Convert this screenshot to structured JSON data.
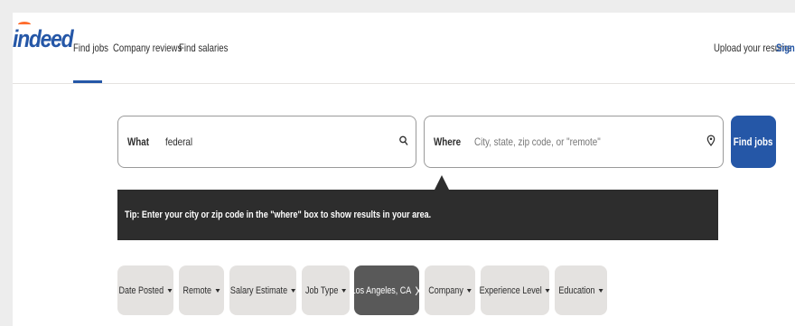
{
  "brand": {
    "logo_text": "indeed",
    "color": "#2557a7",
    "accent": "#ff6d2e"
  },
  "nav": {
    "find_jobs": "Find jobs",
    "company_reviews": "Company reviews",
    "find_salaries": "Find salaries",
    "upload_resume": "Upload your resume",
    "sign_in": "Sign i"
  },
  "search": {
    "what": {
      "label": "What",
      "value": "federal",
      "icon": "search-icon"
    },
    "where": {
      "label": "Where",
      "placeholder": "City, state, zip code, or \"remote\"",
      "icon": "location-pin-icon"
    },
    "submit_label": "Find jobs"
  },
  "tip": {
    "text": "Tip: Enter your city or zip code in the \"where\" box to show results in your area."
  },
  "filters": [
    {
      "label": "Date Posted",
      "active": false
    },
    {
      "label": "Remote",
      "active": false
    },
    {
      "label": "Salary Estimate",
      "active": false
    },
    {
      "label": "Job Type",
      "active": false
    },
    {
      "label": "Los Angeles, CA",
      "active": true
    },
    {
      "label": "Company",
      "active": false
    },
    {
      "label": "Experience Level",
      "active": false
    },
    {
      "label": "Education",
      "active": false
    }
  ],
  "filter_close_glyph": "X"
}
